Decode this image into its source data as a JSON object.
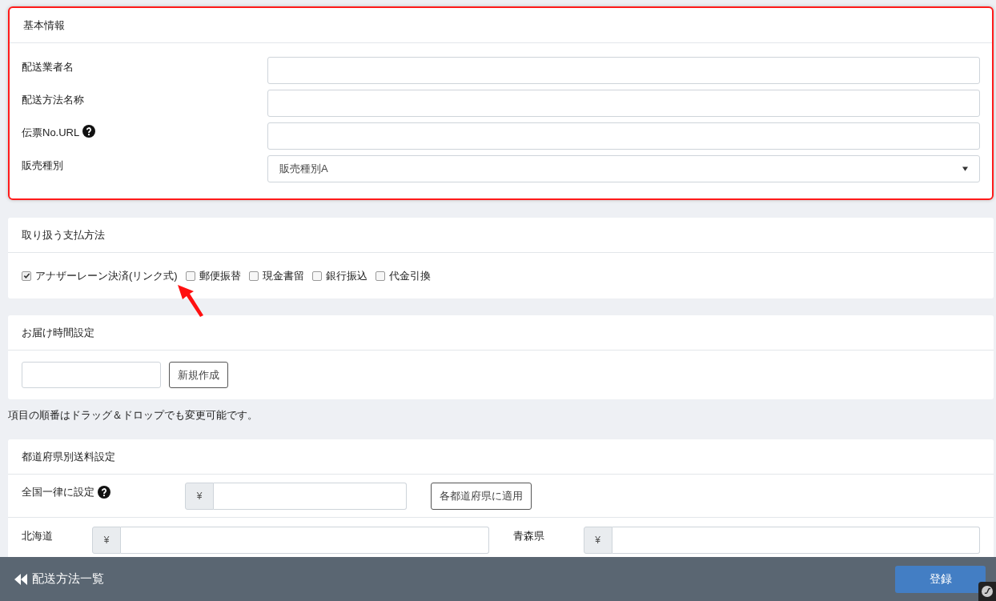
{
  "basic_info": {
    "title": "基本情報",
    "fields": [
      {
        "label": "配送業者名",
        "kind": "text",
        "help": false
      },
      {
        "label": "配送方法名称",
        "kind": "text",
        "help": false
      },
      {
        "label": "伝票No.URL",
        "kind": "text",
        "help": true
      },
      {
        "label": "販売種別",
        "kind": "select",
        "help": false,
        "value": "販売種別A"
      }
    ]
  },
  "payment_methods": {
    "title": "取り扱う支払方法",
    "options": [
      {
        "label": "アナザーレーン決済(リンク式)",
        "checked": true
      },
      {
        "label": "郵便振替",
        "checked": false
      },
      {
        "label": "現金書留",
        "checked": false
      },
      {
        "label": "銀行振込",
        "checked": false
      },
      {
        "label": "代金引換",
        "checked": false
      }
    ]
  },
  "delivery_time": {
    "title": "お届け時間設定",
    "button": "新規作成"
  },
  "note": "項目の順番はドラッグ＆ドロップでも変更可能です。",
  "shipping_fees": {
    "title": "都道府県別送料設定",
    "flat": {
      "label": "全国一律に設定",
      "help": true,
      "currency": "¥",
      "button": "各都道府県に適用"
    },
    "prefectures": [
      {
        "name": "北海道",
        "currency": "¥"
      },
      {
        "name": "青森県",
        "currency": "¥"
      }
    ]
  },
  "footer": {
    "back_link": "配送方法一覧",
    "submit": "登録"
  }
}
